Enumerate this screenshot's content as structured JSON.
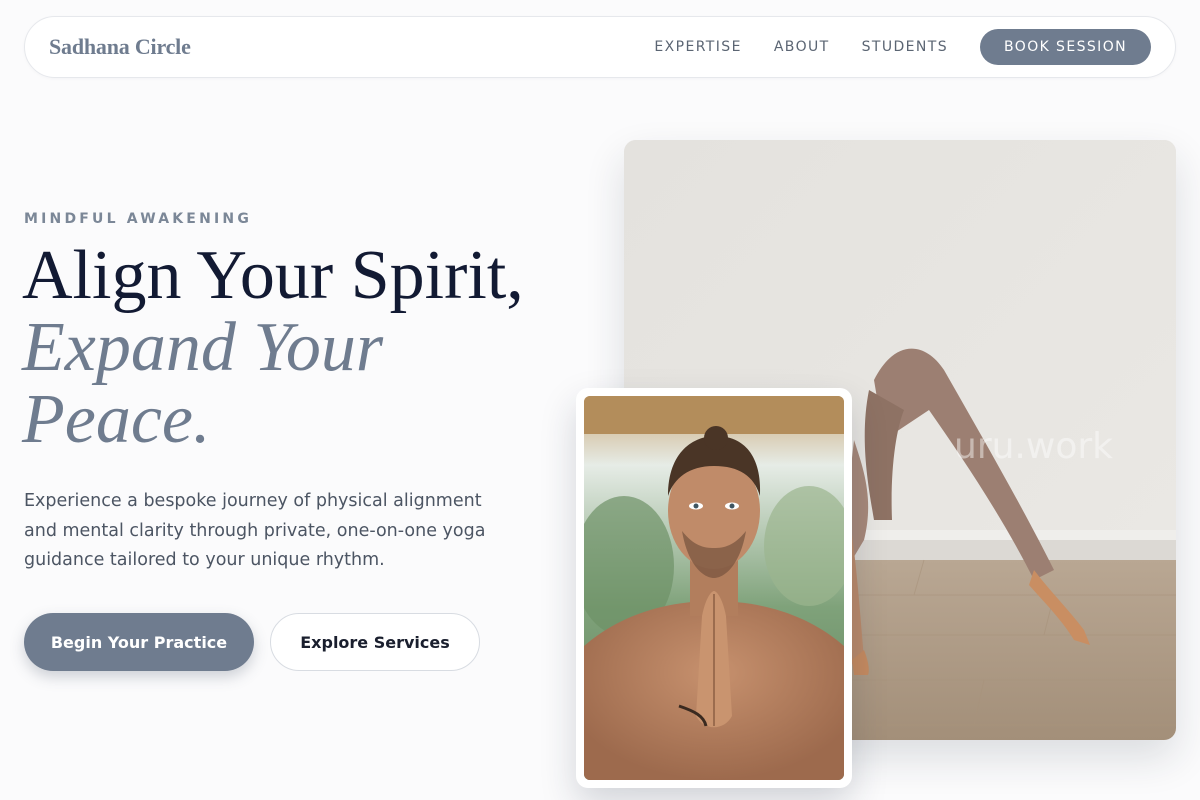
{
  "nav": {
    "logo": "Sadhana Circle",
    "links": [
      "EXPERTISE",
      "ABOUT",
      "STUDENTS"
    ],
    "cta": "BOOK SESSION"
  },
  "hero": {
    "eyebrow": "MINDFUL AWAKENING",
    "headline_line1": "Align Your Spirit,",
    "headline_accent": "Expand Your Peace.",
    "description": "Experience a bespoke journey of physical alignment and mental clarity through private, one-on-one yoga guidance tailored to your unique rhythm.",
    "primary_button": "Begin Your Practice",
    "secondary_button": "Explore Services"
  },
  "images": {
    "main_photo": "yoga-pose-photo",
    "portrait_photo": "instructor-portrait-photo"
  },
  "colors": {
    "accent": "#6f7c8f",
    "heading": "#121a33",
    "background": "#fbfbfc"
  }
}
